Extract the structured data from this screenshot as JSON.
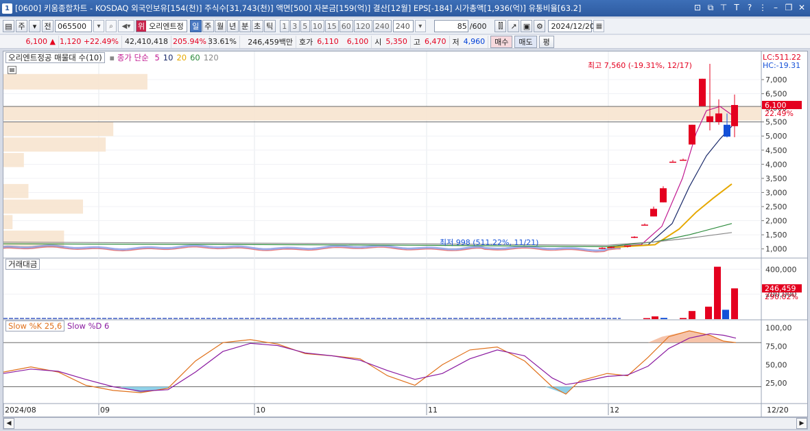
{
  "window": {
    "number": "1",
    "title": "[0600] 키움종합차트 - KOSDAQ 외국인보유[154(천)] 주식수[31,743(천)] 액면[500] 자본금[159(억)] 결산[12월] EPS[-184] 시가총액[1,936(억)] 유통비율[63.2]"
  },
  "toolbar": {
    "period_unit": "주",
    "jeon_label": "전",
    "stock_code": "065500",
    "badge": "위",
    "stock_name": "오리엔트정",
    "timeframes": [
      "일",
      "주",
      "월",
      "년",
      "분",
      "초",
      "틱"
    ],
    "active_timeframe": "일",
    "intervals": [
      "1",
      "3",
      "5",
      "10",
      "15",
      "60",
      "120",
      "240"
    ],
    "interval_select": "240",
    "count_value": "85",
    "count_total": "/600",
    "date": "2024/12/20"
  },
  "quote": {
    "price": "6,100",
    "arrow": "▲",
    "change": "1,120",
    "change_pct": "+22.49%",
    "volume": "42,410,418",
    "vol_ratio": "205.94%",
    "turnover": "33.61%",
    "amount": "246,459백만",
    "hoga_label": "호가",
    "ask": "6,110",
    "bid": "6,100",
    "open_label": "시",
    "open": "5,350",
    "high_label": "고",
    "high": "6,470",
    "low_label": "저",
    "low": "4,960",
    "buy_label": "매수",
    "sell_label": "매도",
    "avg_label": "평"
  },
  "price_pane": {
    "legend_main": "오리엔트정공 매물대 수(10)",
    "ma_label": "종가 단순",
    "ma_periods": [
      "5",
      "10",
      "20",
      "60",
      "120"
    ],
    "ma_colors": [
      "#c01890",
      "#1a2a6a",
      "#e6a800",
      "#2a8a3a",
      "#888888"
    ],
    "lc_label": "LC:511.22",
    "hc_label": "HC:-19.31",
    "max_annotation": "최고 7,560 (-19.31%, 12/17)",
    "min_annotation": "최저 998 (511.22%, 11/21)",
    "current_price_tag": "6,100",
    "current_pct_tag": "22.49%"
  },
  "volume_pane": {
    "label": "거래대금",
    "current_tag": "246,459",
    "current_pct": "290.02%"
  },
  "stoch_pane": {
    "label_k": "Slow %K 25,6",
    "label_d": "Slow %D 6"
  },
  "x_axis": {
    "labels": [
      "2024/08",
      "09",
      "10",
      "11",
      "12"
    ],
    "end_label": "12/20"
  },
  "chart_data": {
    "type": "candlestick",
    "title": "오리엔트정공",
    "price_axis_ticks": [
      1000,
      1500,
      2000,
      2500,
      3000,
      3500,
      4000,
      4500,
      5000,
      5500,
      6000,
      6500,
      7000
    ],
    "price_ylim": [
      700,
      7900
    ],
    "volume_axis_ticks": [
      200000,
      400000
    ],
    "volume_ylim": [
      0,
      440000
    ],
    "stoch_axis_ticks": [
      25,
      50,
      75,
      100
    ],
    "stoch_ylim": [
      0,
      110
    ],
    "stoch_ref_lines": [
      20,
      80
    ],
    "candles_recent": [
      {
        "date": "12/02",
        "open": 1010,
        "high": 1060,
        "low": 995,
        "close": 1040
      },
      {
        "date": "12/03",
        "open": 1040,
        "high": 1090,
        "low": 1020,
        "close": 1070
      },
      {
        "date": "12/04",
        "open": 1080,
        "high": 1130,
        "low": 1050,
        "close": 1120
      },
      {
        "date": "12/05",
        "open": 1400,
        "high": 1450,
        "low": 1380,
        "close": 1430
      },
      {
        "date": "12/06",
        "open": 1860,
        "high": 1900,
        "low": 1850,
        "close": 1860
      },
      {
        "date": "12/09",
        "open": 2150,
        "high": 2500,
        "low": 2150,
        "close": 2420
      },
      {
        "date": "12/10",
        "open": 2650,
        "high": 3220,
        "low": 2650,
        "close": 3150
      },
      {
        "date": "12/11",
        "open": 4090,
        "high": 4150,
        "low": 4090,
        "close": 4090
      },
      {
        "date": "12/12",
        "open": 4150,
        "high": 4200,
        "low": 4150,
        "close": 4160
      },
      {
        "date": "12/13",
        "open": 4700,
        "high": 5400,
        "low": 4700,
        "close": 5400
      },
      {
        "date": "12/16",
        "open": 6060,
        "high": 7030,
        "low": 6060,
        "close": 7030
      },
      {
        "date": "12/17",
        "open": 5500,
        "high": 7560,
        "low": 5200,
        "close": 5700
      },
      {
        "date": "12/18",
        "open": 5500,
        "high": 6300,
        "low": 5400,
        "close": 5800
      },
      {
        "date": "12/19",
        "open": 5400,
        "high": 5800,
        "low": 4950,
        "close": 4980
      },
      {
        "date": "12/20",
        "open": 5350,
        "high": 6470,
        "low": 4960,
        "close": 6100
      }
    ],
    "volume_recent": [
      {
        "date": "12/09",
        "value": 8000,
        "color": "red"
      },
      {
        "date": "12/10",
        "value": 22000,
        "color": "red"
      },
      {
        "date": "12/11",
        "value": 10000,
        "color": "blue"
      },
      {
        "date": "12/12",
        "value": 9000,
        "color": "red"
      },
      {
        "date": "12/16",
        "value": 65000,
        "color": "red"
      },
      {
        "date": "12/17",
        "value": 100000,
        "color": "red"
      },
      {
        "date": "12/18",
        "value": 420000,
        "color": "red"
      },
      {
        "date": "12/19",
        "value": 75000,
        "color": "blue"
      },
      {
        "date": "12/19b",
        "value": 55000,
        "color": "blue"
      },
      {
        "date": "12/20",
        "value": 246459,
        "color": "red"
      }
    ],
    "volume_profile_bands": [
      {
        "price_from": 6600,
        "price_to": 7200,
        "strength": 0.19
      },
      {
        "price_from": 5500,
        "price_to": 6050,
        "strength": 1.0
      },
      {
        "price_from": 4950,
        "price_to": 5500,
        "strength": 0.145
      },
      {
        "price_from": 4400,
        "price_to": 4950,
        "strength": 0.135
      },
      {
        "price_from": 3850,
        "price_to": 4400,
        "strength": 0.027
      },
      {
        "price_from": 2750,
        "price_to": 3300,
        "strength": 0.033
      },
      {
        "price_from": 2200,
        "price_to": 2750,
        "strength": 0.105
      },
      {
        "price_from": 1650,
        "price_to": 2200,
        "strength": 0.012
      },
      {
        "price_from": 1000,
        "price_to": 1650,
        "strength": 0.08
      }
    ]
  }
}
